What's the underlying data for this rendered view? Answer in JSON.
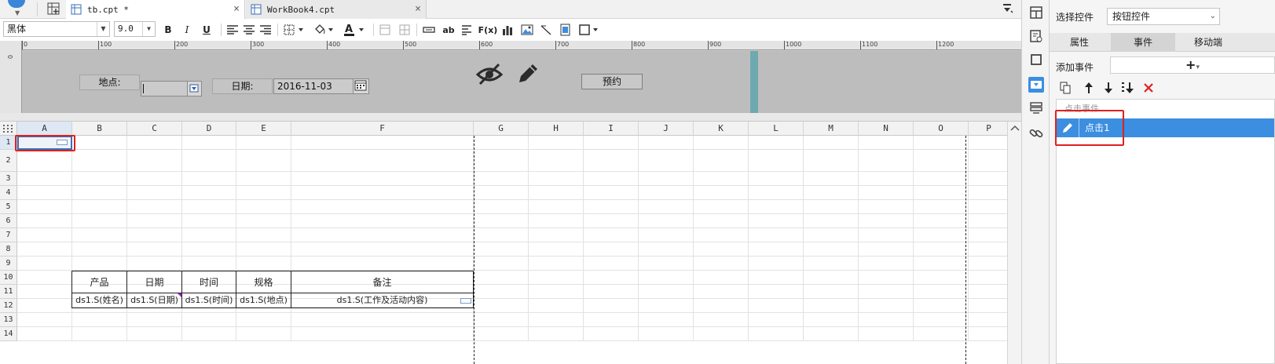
{
  "tabs": [
    {
      "label": "tb.cpt *",
      "close": "×"
    },
    {
      "label": "WorkBook4.cpt",
      "close": "×"
    }
  ],
  "toolbar": {
    "font_name": "黑体",
    "font_size": "9.0",
    "bold": "B",
    "italic": "I",
    "underline": "U",
    "wrap": "ab",
    "formula": "F(x)"
  },
  "ruler": {
    "labels": [
      "0",
      "100",
      "200",
      "300",
      "400",
      "500",
      "600",
      "700",
      "800",
      "900",
      "1000",
      "1100",
      "1200"
    ],
    "v_label": "0"
  },
  "form": {
    "location_label": "地点:",
    "date_label": "日期:",
    "date_value": "2016-11-03",
    "button_label": "预约"
  },
  "sheet": {
    "columns": [
      "A",
      "B",
      "C",
      "D",
      "E",
      "F",
      "G",
      "H",
      "I",
      "J",
      "K",
      "L",
      "M",
      "N",
      "O",
      "P"
    ],
    "rows": [
      "1",
      "2",
      "3",
      "4",
      "5",
      "6",
      "7",
      "8",
      "9",
      "10",
      "11",
      "12",
      "13",
      "14"
    ],
    "headers": [
      "产品",
      "日期",
      "时间",
      "规格",
      "备注"
    ],
    "fields": [
      "ds1.S(姓名)",
      "ds1.S(日期)",
      "ds1.S(时间)",
      "ds1.S(地点)",
      "ds1.S(工作及活动内容)"
    ]
  },
  "panel": {
    "select_control_label": "选择控件",
    "select_control_value": "按钮控件",
    "tabs": [
      "属性",
      "事件",
      "移动端"
    ],
    "active_tab": "事件",
    "add_event_label": "添加事件",
    "add_event_symbol": "+",
    "event_category": "点击事件",
    "event_item": "点击1"
  },
  "colors": {
    "accent": "#3b8ee0",
    "highlight": "#e02020",
    "guide": "#5fa6ad"
  }
}
